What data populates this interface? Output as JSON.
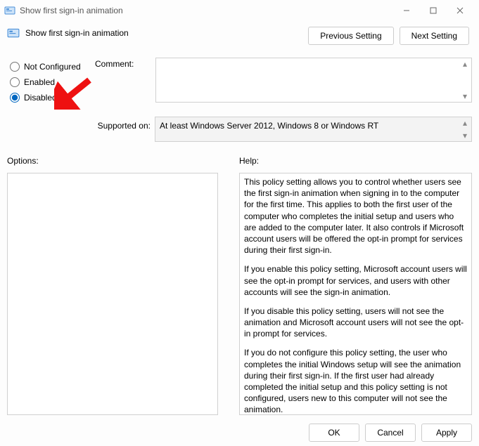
{
  "titlebar": {
    "title": "Show first sign-in animation"
  },
  "header": {
    "policy_name": "Show first sign-in animation"
  },
  "nav": {
    "prev": "Previous Setting",
    "next": "Next Setting"
  },
  "radios": {
    "not_configured": "Not Configured",
    "enabled": "Enabled",
    "disabled": "Disabled",
    "selected": "disabled"
  },
  "labels": {
    "comment": "Comment:",
    "supported": "Supported on:",
    "options": "Options:",
    "help": "Help:"
  },
  "comment_value": "",
  "supported_value": "At least Windows Server 2012, Windows 8 or Windows RT",
  "help_text": {
    "p1": "This policy setting allows you to control whether users see the first sign-in animation when signing in to the computer for the first time.  This applies to both the first user of the computer who completes the initial setup and users who are added to the computer later.  It also controls if Microsoft account users will be offered the opt-in prompt for services during their first sign-in.",
    "p2": "If you enable this policy setting, Microsoft account users will see the opt-in prompt for services, and users with other accounts will see the sign-in animation.",
    "p3": "If you disable this policy setting, users will not see the animation and Microsoft account users will not see the opt-in prompt for services.",
    "p4": "If you do not configure this policy setting, the user who completes the initial Windows setup will see the animation during their first sign-in. If the first user had already completed the initial setup and this policy setting is not configured, users new to this computer will not see the animation."
  },
  "footer": {
    "ok": "OK",
    "cancel": "Cancel",
    "apply": "Apply"
  }
}
